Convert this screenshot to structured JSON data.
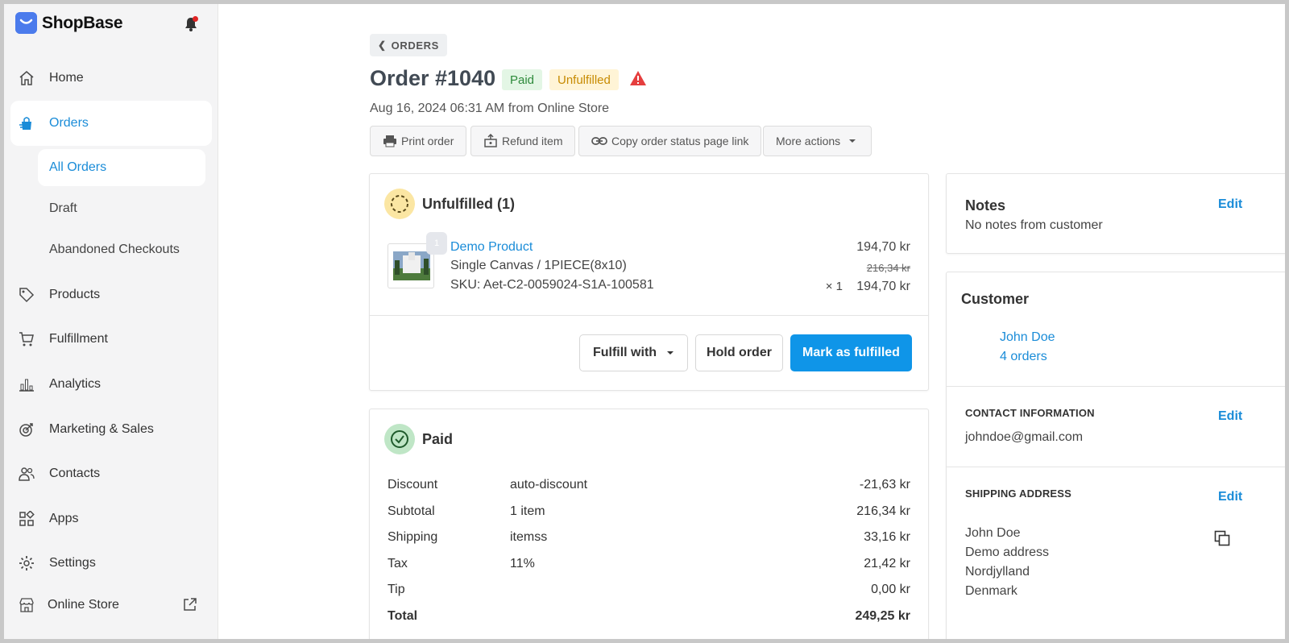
{
  "brand": {
    "name": "ShopBase"
  },
  "sidebar": {
    "items": [
      {
        "label": "Home",
        "icon": "home-icon"
      },
      {
        "label": "Orders",
        "icon": "orders-icon"
      },
      {
        "label": "Products",
        "icon": "tag-icon"
      },
      {
        "label": "Fulfillment",
        "icon": "cart-icon"
      },
      {
        "label": "Analytics",
        "icon": "bar-chart-icon"
      },
      {
        "label": "Marketing & Sales",
        "icon": "target-icon"
      },
      {
        "label": "Contacts",
        "icon": "users-icon"
      },
      {
        "label": "Apps",
        "icon": "apps-icon"
      },
      {
        "label": "Settings",
        "icon": "gear-icon"
      },
      {
        "label": "Online Store",
        "icon": "store-icon"
      }
    ],
    "orders_sub": [
      "All Orders",
      "Draft",
      "Abandoned Checkouts"
    ]
  },
  "breadcrumb": {
    "label": "ORDERS"
  },
  "order": {
    "title": "Order #1040",
    "payment_status": "Paid",
    "fulfillment_status": "Unfulfilled",
    "meta": "Aug 16, 2024 06:31 AM from Online Store"
  },
  "toolbar": {
    "print": "Print order",
    "refund": "Refund item",
    "copy_link": "Copy order status page link",
    "more": "More actions"
  },
  "unfulfilled": {
    "heading": "Unfulfilled (1)",
    "item": {
      "qty_badge": "1",
      "name": "Demo Product",
      "variant": "Single Canvas / 1PIECE(8x10)",
      "sku": "SKU: Aet-C2-0059024-S1A-100581",
      "price": "194,70 kr",
      "original_price": "216,34 kr",
      "qty": "× 1",
      "line_total": "194,70 kr"
    },
    "fulfill_with": "Fulfill with",
    "hold": "Hold order",
    "mark_fulfilled": "Mark as fulfilled"
  },
  "paid": {
    "heading": "Paid",
    "rows": [
      {
        "label": "Discount",
        "detail": "auto-discount",
        "amount": "-21,63 kr"
      },
      {
        "label": "Subtotal",
        "detail": "1 item",
        "amount": "216,34 kr"
      },
      {
        "label": "Shipping",
        "detail": "itemss",
        "amount": "33,16 kr"
      },
      {
        "label": "Tax",
        "detail": "11%",
        "amount": "21,42 kr"
      },
      {
        "label": "Tip",
        "detail": "",
        "amount": "0,00 kr"
      },
      {
        "label": "Total",
        "detail": "",
        "amount": "249,25 kr"
      }
    ]
  },
  "notes": {
    "title": "Notes",
    "edit": "Edit",
    "text": "No notes from customer"
  },
  "customer": {
    "title": "Customer",
    "name": "John Doe",
    "orders": "4 orders",
    "contact_caption": "CONTACT INFORMATION",
    "contact_edit": "Edit",
    "email": "johndoe@gmail.com",
    "shipping_caption": "SHIPPING ADDRESS",
    "shipping_edit": "Edit",
    "address": [
      "John Doe",
      "Demo address",
      "Nordjylland",
      "Denmark"
    ]
  },
  "colors": {
    "accent": "#0f95e8",
    "paid_bg": "#e3f6e5",
    "unfulfilled_bg": "#fff4d6"
  }
}
